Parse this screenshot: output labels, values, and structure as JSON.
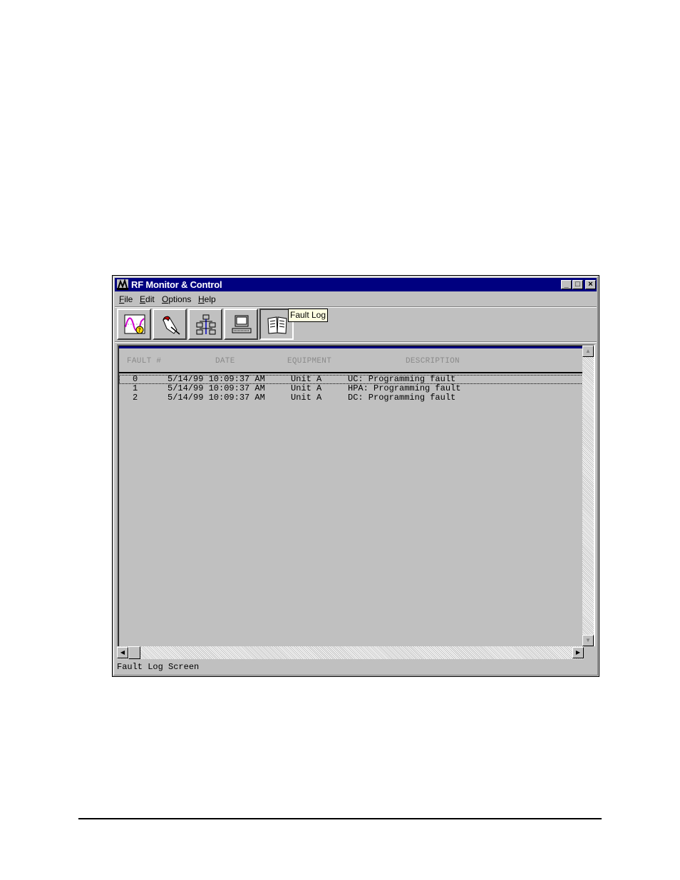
{
  "window": {
    "title": "RF Monitor & Control",
    "controls": {
      "minimize": "_",
      "maximize": "□",
      "close": "×"
    }
  },
  "menu": [
    {
      "label": "File",
      "accel": "F"
    },
    {
      "label": "Edit",
      "accel": "E"
    },
    {
      "label": "Options",
      "accel": "O"
    },
    {
      "label": "Help",
      "accel": "H"
    }
  ],
  "toolbar": {
    "buttons": [
      "spectrum-analyzer-icon",
      "hand-pointer-icon",
      "network-icon",
      "computer-icon",
      "book-icon"
    ],
    "tooltip": "Fault Log"
  },
  "fault_log": {
    "columns": [
      "FAULT #",
      "DATE",
      "EQUIPMENT",
      "DESCRIPTION"
    ],
    "rows": [
      {
        "num": "0",
        "date": "5/14/99 10:09:37 AM",
        "equipment": "Unit A",
        "description": "UC: Programming fault"
      },
      {
        "num": "1",
        "date": "5/14/99 10:09:37 AM",
        "equipment": "Unit A",
        "description": "HPA: Programming fault"
      },
      {
        "num": "2",
        "date": "5/14/99 10:09:37 AM",
        "equipment": "Unit A",
        "description": "DC: Programming fault"
      }
    ]
  },
  "status_bar": "Fault Log Screen",
  "colors": {
    "titlebar": "#000080",
    "face": "#c0c0c0",
    "tooltip": "#ffffe1"
  }
}
